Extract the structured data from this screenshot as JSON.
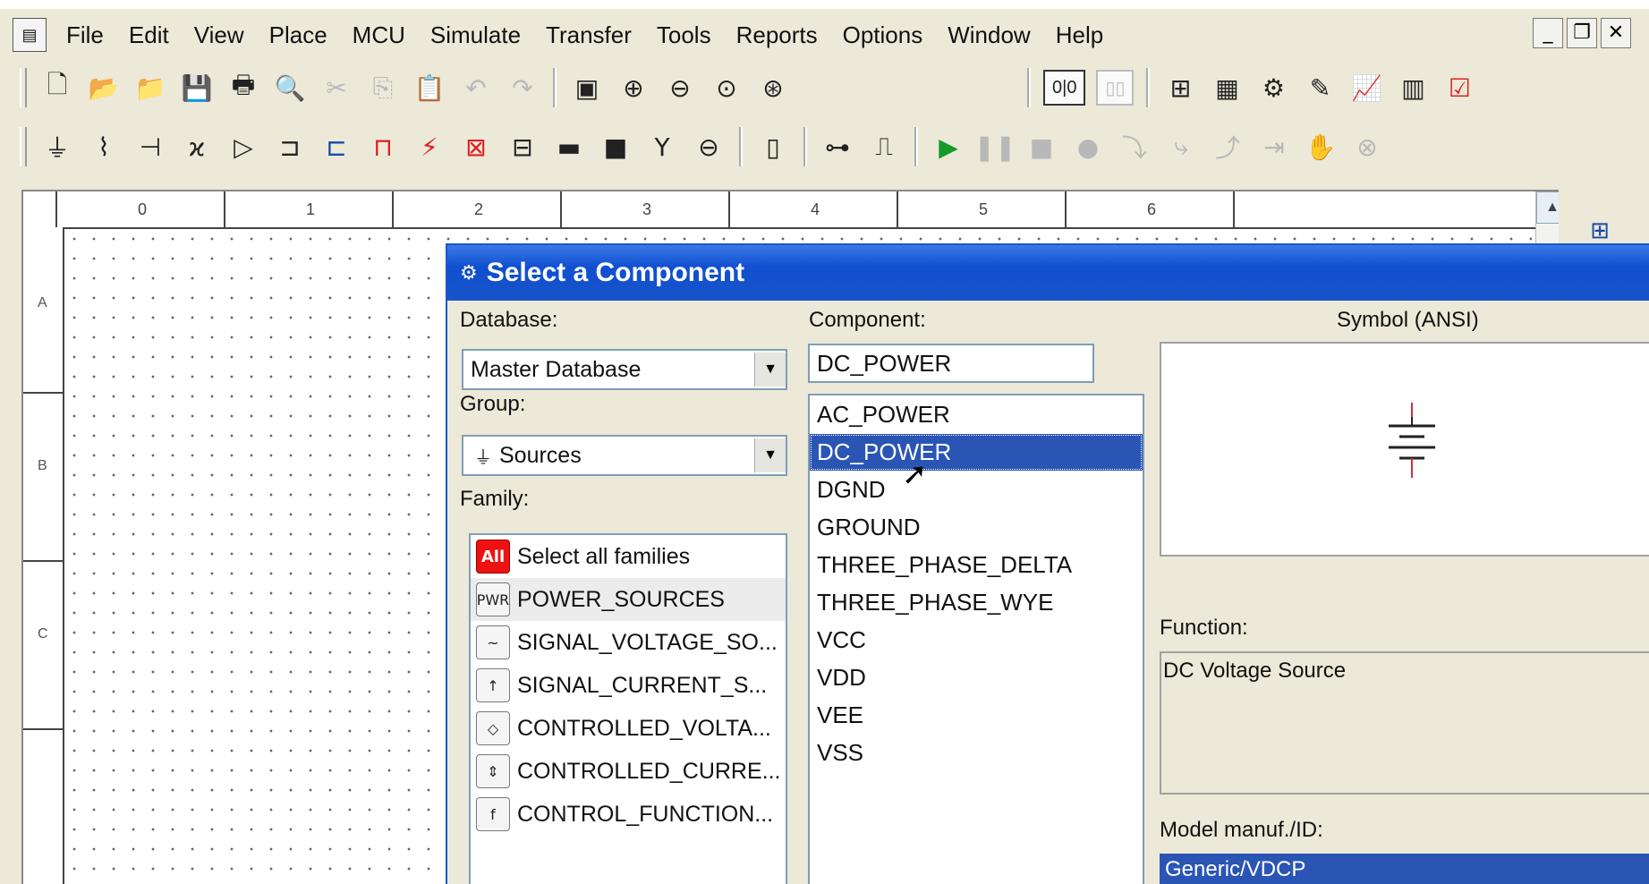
{
  "menubar": {
    "items": [
      "File",
      "Edit",
      "View",
      "Place",
      "MCU",
      "Simulate",
      "Transfer",
      "Tools",
      "Reports",
      "Options",
      "Window",
      "Help"
    ]
  },
  "window_controls": {
    "minimize": "_",
    "restore": "❐",
    "close": "✕"
  },
  "toolbar": {
    "zoom_wide_label": "0|0",
    "zoom_wide2_label": "▯▯"
  },
  "ruler": {
    "top_labels": [
      "0",
      "1",
      "2",
      "3",
      "4",
      "5",
      "6"
    ],
    "left_labels": [
      "A",
      "B",
      "C"
    ]
  },
  "dialog": {
    "title": "Select a Component",
    "database_label": "Database:",
    "database_value": "Master Database",
    "group_label": "Group:",
    "group_value": "Sources",
    "family_label": "Family:",
    "families": [
      {
        "icon": "All",
        "label": "Select all families"
      },
      {
        "icon": "PWR",
        "label": "POWER_SOURCES"
      },
      {
        "icon": "~",
        "label": "SIGNAL_VOLTAGE_SO..."
      },
      {
        "icon": "↑",
        "label": "SIGNAL_CURRENT_S..."
      },
      {
        "icon": "◇",
        "label": "CONTROLLED_VOLTA..."
      },
      {
        "icon": "⇕",
        "label": "CONTROLLED_CURRE..."
      },
      {
        "icon": "f",
        "label": "CONTROL_FUNCTION..."
      }
    ],
    "selected_family_index": 1,
    "component_label": "Component:",
    "component_value": "DC_POWER",
    "components": [
      "AC_POWER",
      "DC_POWER",
      "DGND",
      "GROUND",
      "THREE_PHASE_DELTA",
      "THREE_PHASE_WYE",
      "VCC",
      "VDD",
      "VEE",
      "VSS"
    ],
    "selected_component_index": 1,
    "symbol_label": "Symbol (ANSI)",
    "function_label": "Function:",
    "function_value": "DC Voltage Source",
    "model_label": "Model manuf./ID:",
    "model_value": "Generic/VDCP"
  },
  "colors": {
    "title_bar": "#0f4fd0",
    "selection": "#2a55b5",
    "window_bg": "#ece9d8"
  }
}
